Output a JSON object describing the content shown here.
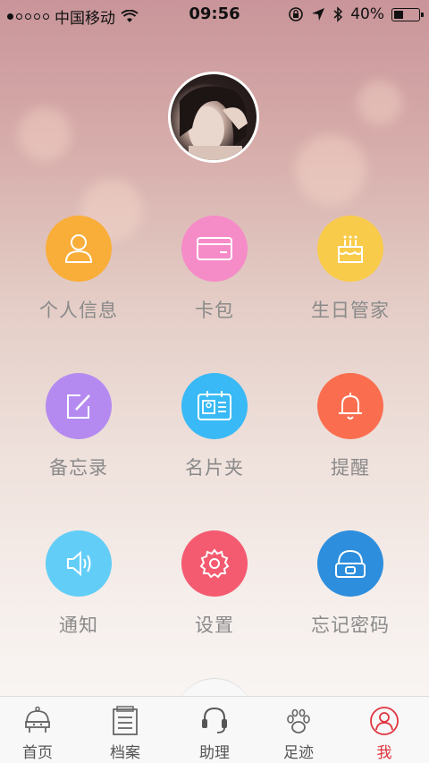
{
  "status_bar": {
    "carrier": "中国移动",
    "time": "09:56",
    "battery_percent": "40%",
    "battery_level": 0.4
  },
  "menu": [
    {
      "label": "个人信息",
      "color": "#f9ae3a",
      "icon": "person-icon"
    },
    {
      "label": "卡包",
      "color": "#f58cc8",
      "icon": "card-icon"
    },
    {
      "label": "生日管家",
      "color": "#f9cb4b",
      "icon": "cake-icon"
    },
    {
      "label": "备忘录",
      "color": "#b58af0",
      "icon": "memo-icon"
    },
    {
      "label": "名片夹",
      "color": "#39b9f5",
      "icon": "business-card-icon"
    },
    {
      "label": "提醒",
      "color": "#fa6e4f",
      "icon": "bell-icon"
    },
    {
      "label": "通知",
      "color": "#62cef8",
      "icon": "speaker-icon"
    },
    {
      "label": "设置",
      "color": "#f45b70",
      "icon": "gear-icon"
    },
    {
      "label": "忘记密码",
      "color": "#2d8edd",
      "icon": "lock-icon"
    }
  ],
  "tabs": [
    {
      "label": "首页",
      "icon": "home-icon"
    },
    {
      "label": "档案",
      "icon": "archive-icon"
    },
    {
      "label": "助理",
      "icon": "headset-icon"
    },
    {
      "label": "足迹",
      "icon": "pawprint-icon"
    },
    {
      "label": "我",
      "icon": "user-icon",
      "active": true
    }
  ],
  "colors": {
    "active_tab": "#e0343f",
    "label_gray": "#8a8a8a"
  }
}
